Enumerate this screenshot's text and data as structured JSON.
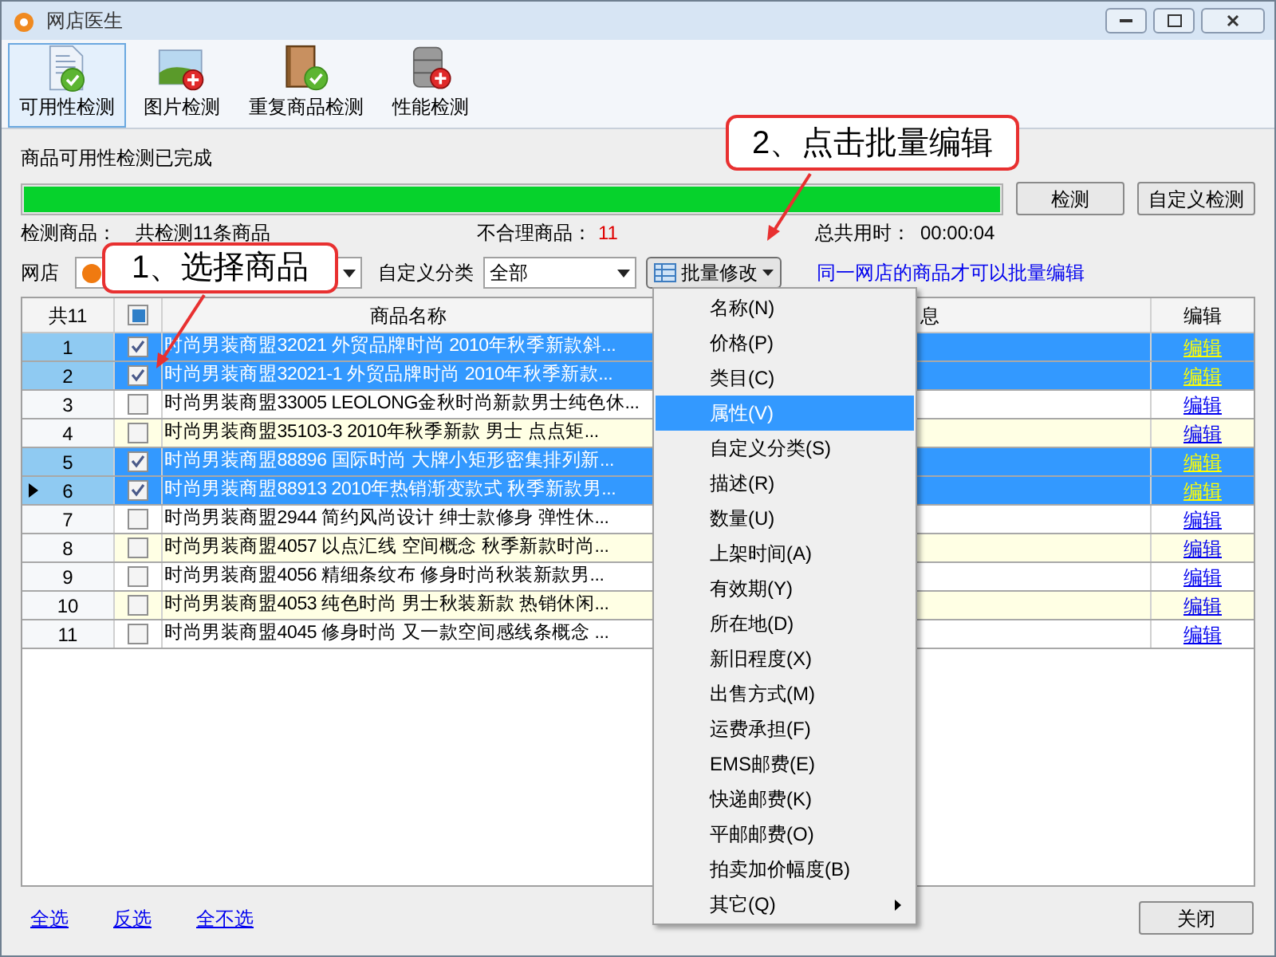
{
  "window": {
    "title": "网店医生"
  },
  "toolbar": [
    {
      "label": "可用性检测",
      "selected": true,
      "kind": "document"
    },
    {
      "label": "图片检测",
      "selected": false,
      "kind": "picture"
    },
    {
      "label": "重复商品检测",
      "selected": false,
      "kind": "book"
    },
    {
      "label": "性能检测",
      "selected": false,
      "kind": "database"
    }
  ],
  "status": "商品可用性检测已完成",
  "progress": {
    "level": 1
  },
  "buttons": {
    "check": "检测",
    "custom_check": "自定义检测"
  },
  "summary": {
    "checked_label": "检测商品：",
    "checked_value": "共检测11条商品",
    "invalid_label": "不合理商品：",
    "invalid_value": "11",
    "time_label": "总共用时：",
    "time_value": "00:00:04"
  },
  "filters": {
    "shop_label": "网店",
    "category_label": "自定义分类",
    "category_value": "全部",
    "batch_button": "批量修改",
    "hint": "同一网店的商品才可以批量编辑"
  },
  "table": {
    "count": "共11",
    "select_all_indeterminate": true,
    "columns": [
      "商品名称",
      "息",
      "编辑"
    ],
    "rows": [
      {
        "number": "1",
        "checked": true,
        "current": false,
        "name": "时尚男装商盟32021 外贸品牌时尚 2010年秋季新款斜...",
        "edit": "编辑"
      },
      {
        "number": "2",
        "checked": true,
        "current": false,
        "name": "时尚男装商盟32021-1 外贸品牌时尚 2010年秋季新款...",
        "edit": "编辑"
      },
      {
        "number": "3",
        "checked": false,
        "current": false,
        "name": "时尚男装商盟33005 LEOLONG金秋时尚新款男士纯色休...",
        "edit": "编辑"
      },
      {
        "number": "4",
        "checked": false,
        "current": false,
        "name": "时尚男装商盟35103-3 2010年秋季新款 男士 点点矩...",
        "edit": "编辑"
      },
      {
        "number": "5",
        "checked": true,
        "current": false,
        "name": "时尚男装商盟88896 国际时尚 大牌小矩形密集排列新...",
        "edit": "编辑"
      },
      {
        "number": "6",
        "checked": true,
        "current": true,
        "name": "时尚男装商盟88913 2010年热销渐变款式 秋季新款男...",
        "edit": "编辑"
      },
      {
        "number": "7",
        "checked": false,
        "current": false,
        "name": "时尚男装商盟2944 简约风尚设计 绅士款修身 弹性休...",
        "edit": "编辑"
      },
      {
        "number": "8",
        "checked": false,
        "current": false,
        "name": "时尚男装商盟4057 以点汇线 空间概念 秋季新款时尚...",
        "edit": "编辑"
      },
      {
        "number": "9",
        "checked": false,
        "current": false,
        "name": "时尚男装商盟4056 精细条纹布 修身时尚秋装新款男...",
        "edit": "编辑"
      },
      {
        "number": "10",
        "checked": false,
        "current": false,
        "name": "时尚男装商盟4053 纯色时尚 男士秋装新款 热销休闲...",
        "edit": "编辑"
      },
      {
        "number": "11",
        "checked": false,
        "current": false,
        "name": "时尚男装商盟4045 修身时尚 又一款空间感线条概念 ...",
        "edit": "编辑"
      }
    ]
  },
  "menu": {
    "items": [
      {
        "label": "名称(N)",
        "selected": false,
        "submenu": false
      },
      {
        "label": "价格(P)",
        "selected": false,
        "submenu": false
      },
      {
        "label": "类目(C)",
        "selected": false,
        "submenu": false
      },
      {
        "label": "属性(V)",
        "selected": true,
        "submenu": false
      },
      {
        "label": "自定义分类(S)",
        "selected": false,
        "submenu": false
      },
      {
        "label": "描述(R)",
        "selected": false,
        "submenu": false
      },
      {
        "label": "数量(U)",
        "selected": false,
        "submenu": false
      },
      {
        "label": "上架时间(A)",
        "selected": false,
        "submenu": false
      },
      {
        "label": "有效期(Y)",
        "selected": false,
        "submenu": false
      },
      {
        "label": "所在地(D)",
        "selected": false,
        "submenu": false
      },
      {
        "label": "新旧程度(X)",
        "selected": false,
        "submenu": false
      },
      {
        "label": "出售方式(M)",
        "selected": false,
        "submenu": false
      },
      {
        "label": "运费承担(F)",
        "selected": false,
        "submenu": false
      },
      {
        "label": "EMS邮费(E)",
        "selected": false,
        "submenu": false
      },
      {
        "label": "快递邮费(K)",
        "selected": false,
        "submenu": false
      },
      {
        "label": "平邮邮费(O)",
        "selected": false,
        "submenu": false
      },
      {
        "label": "拍卖加价幅度(B)",
        "selected": false,
        "submenu": false
      },
      {
        "label": "其它(Q)",
        "selected": false,
        "submenu": true
      }
    ]
  },
  "footer": {
    "links": [
      "全选",
      "反选",
      "全不选"
    ],
    "close": "关闭"
  },
  "callouts": [
    {
      "text": "1、选择商品"
    },
    {
      "text": "2、点击批量编辑"
    }
  ]
}
